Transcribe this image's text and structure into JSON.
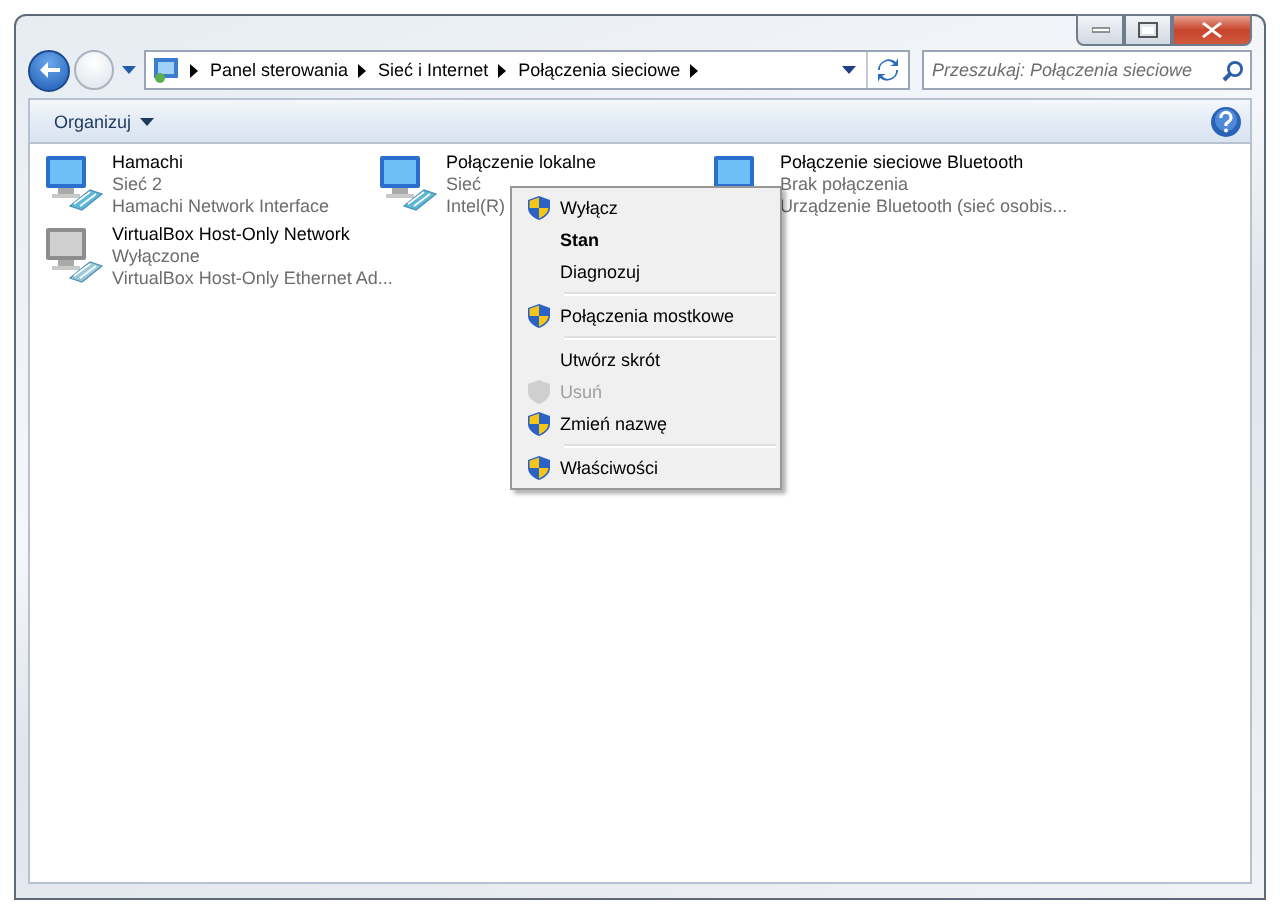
{
  "address_bar": {
    "crumbs": [
      "Panel sterowania",
      "Sieć i Internet",
      "Połączenia sieciowe"
    ]
  },
  "search": {
    "placeholder": "Przeszukaj: Połączenia sieciowe"
  },
  "toolbar": {
    "organize": "Organizuj"
  },
  "connections": [
    {
      "name": "Hamachi",
      "status": "Sieć  2",
      "device": "Hamachi Network Interface",
      "enabled": true
    },
    {
      "name": "Połączenie lokalne",
      "status": "Sieć",
      "device": "Intel(R)",
      "enabled": true
    },
    {
      "name": "Połączenie sieciowe Bluetooth",
      "status": "Brak połączenia",
      "device": "Urządzenie Bluetooth (sieć osobis...",
      "enabled": true
    },
    {
      "name": "VirtualBox Host-Only Network",
      "status": "Wyłączone",
      "device": "VirtualBox Host-Only Ethernet Ad...",
      "enabled": false
    }
  ],
  "context_menu": [
    {
      "kind": "item",
      "label": "Wyłącz",
      "shield": true,
      "default": false,
      "disabled": false
    },
    {
      "kind": "item",
      "label": "Stan",
      "shield": false,
      "default": true,
      "disabled": false
    },
    {
      "kind": "item",
      "label": "Diagnozuj",
      "shield": false,
      "default": false,
      "disabled": false
    },
    {
      "kind": "separator"
    },
    {
      "kind": "item",
      "label": "Połączenia mostkowe",
      "shield": true,
      "default": false,
      "disabled": false
    },
    {
      "kind": "separator"
    },
    {
      "kind": "item",
      "label": "Utwórz skrót",
      "shield": false,
      "default": false,
      "disabled": false
    },
    {
      "kind": "item",
      "label": "Usuń",
      "shield": true,
      "default": false,
      "disabled": true
    },
    {
      "kind": "item",
      "label": "Zmień nazwę",
      "shield": true,
      "default": false,
      "disabled": false
    },
    {
      "kind": "separator"
    },
    {
      "kind": "item",
      "label": "Właściwości",
      "shield": true,
      "default": false,
      "disabled": false
    }
  ]
}
